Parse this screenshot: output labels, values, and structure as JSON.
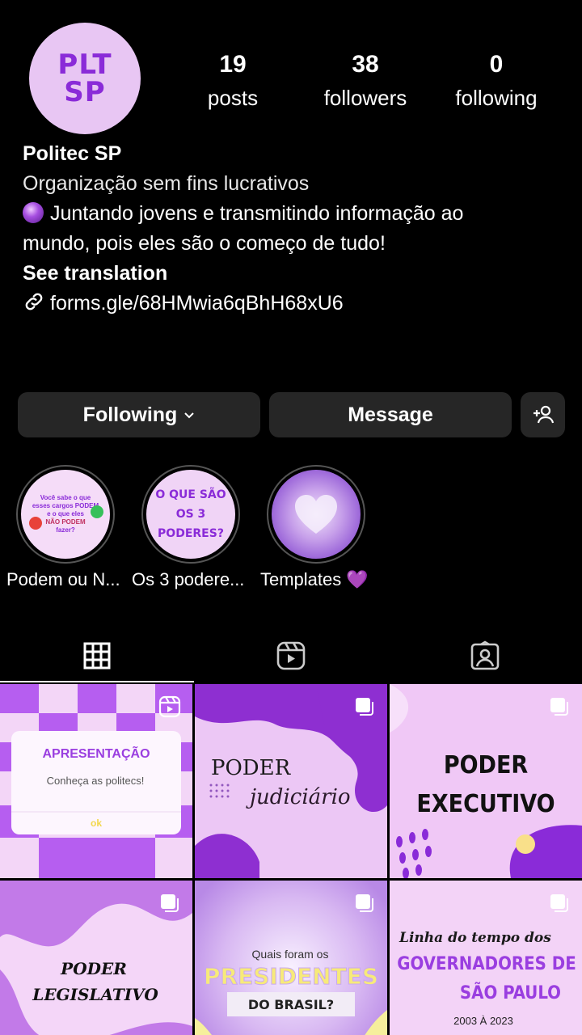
{
  "profile": {
    "avatar_line1": "PLT",
    "avatar_line2": "SP",
    "stats": {
      "posts": {
        "value": "19",
        "label": "posts"
      },
      "followers": {
        "value": "38",
        "label": "followers"
      },
      "following": {
        "value": "0",
        "label": "following"
      }
    },
    "name": "Politec SP",
    "category": "Organização sem fins lucrativos",
    "bio_line1": "Juntando jovens e transmitindo informação ao",
    "bio_line2": "mundo, pois eles são o começo de tudo!",
    "see_translation": "See translation",
    "link": "forms.gle/68HMwia6qBhH68xU6"
  },
  "actions": {
    "following_label": "Following",
    "message_label": "Message"
  },
  "highlights": [
    {
      "label": "Podem ou N...",
      "art_line1": "Você sabe o que",
      "art_line2": "esses cargos PODEM",
      "art_line3": "e o que eles",
      "art_line4": "NÃO PODEM",
      "art_line5": "fazer?"
    },
    {
      "label": "Os 3 podere...",
      "art_line1": "O QUE SÃO",
      "art_line2": "OS 3",
      "art_line3": "PODERES?"
    },
    {
      "label": "Templates",
      "emoji": "💜"
    }
  ],
  "posts": [
    {
      "title": "APRESENTAÇÃO",
      "subtitle": "Conheça as politecs!",
      "button": "ok",
      "badge": "reel-icon"
    },
    {
      "title": "PODER",
      "script": "judiciário",
      "badge": "carousel-icon"
    },
    {
      "title": "PODER",
      "title2": "EXECUTIVO",
      "badge": "carousel-icon"
    },
    {
      "title": "PODER",
      "title2": "LEGISLATIVO",
      "badge": "carousel-icon"
    },
    {
      "pre": "Quais foram os",
      "title": "PRESIDENTES",
      "sub": "DO BRASIL?",
      "badge": "carousel-icon"
    },
    {
      "pre": "Linha do tempo dos",
      "title": "GOVERNADORES DE",
      "title2": "SÃO PAULO",
      "sub": "2003 À 2023",
      "badge": "carousel-icon"
    }
  ],
  "colors": {
    "accent": "#8a2bd8",
    "button_bg": "#262626",
    "bg": "#000000"
  }
}
